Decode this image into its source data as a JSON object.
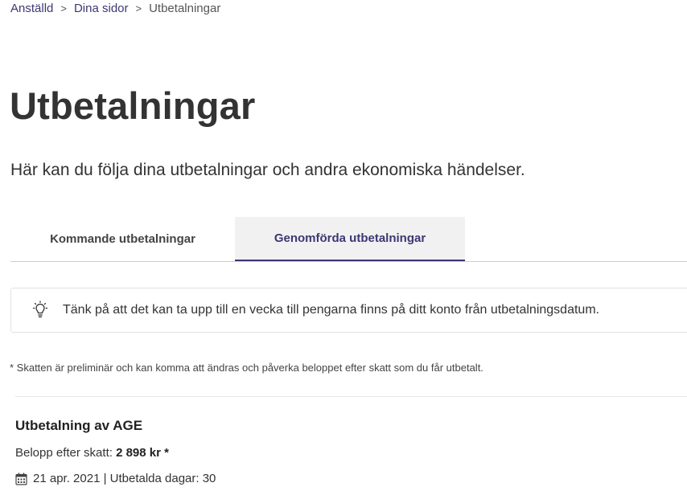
{
  "breadcrumb": {
    "items": [
      "Anställd",
      "Dina sidor"
    ],
    "current": "Utbetalningar",
    "separator": ">"
  },
  "page": {
    "title": "Utbetalningar",
    "lead": "Här kan du följa dina utbetalningar och andra ekonomiska händelser."
  },
  "tabs": [
    {
      "label": "Kommande utbetalningar",
      "active": false
    },
    {
      "label": "Genomförda utbetalningar",
      "active": true
    }
  ],
  "info": {
    "icon": "lightbulb-icon",
    "text": "Tänk på att det kan ta upp till en vecka till pengarna finns på ditt konto från utbetalningsdatum."
  },
  "note": "* Skatten är preliminär och kan komma att ändras och påverka beloppet efter skatt som du får utbetalt.",
  "payment": {
    "title": "Utbetalning av AGE",
    "amount_label": "Belopp efter skatt:",
    "amount_value": "2 898 kr *",
    "date_text": "21 apr. 2021 | Utbetalda dagar: 30",
    "date_icon": "calendar-icon"
  },
  "colors": {
    "accent": "#3c3774",
    "text": "#333333",
    "tab_active_bg": "#f1f1f1"
  }
}
